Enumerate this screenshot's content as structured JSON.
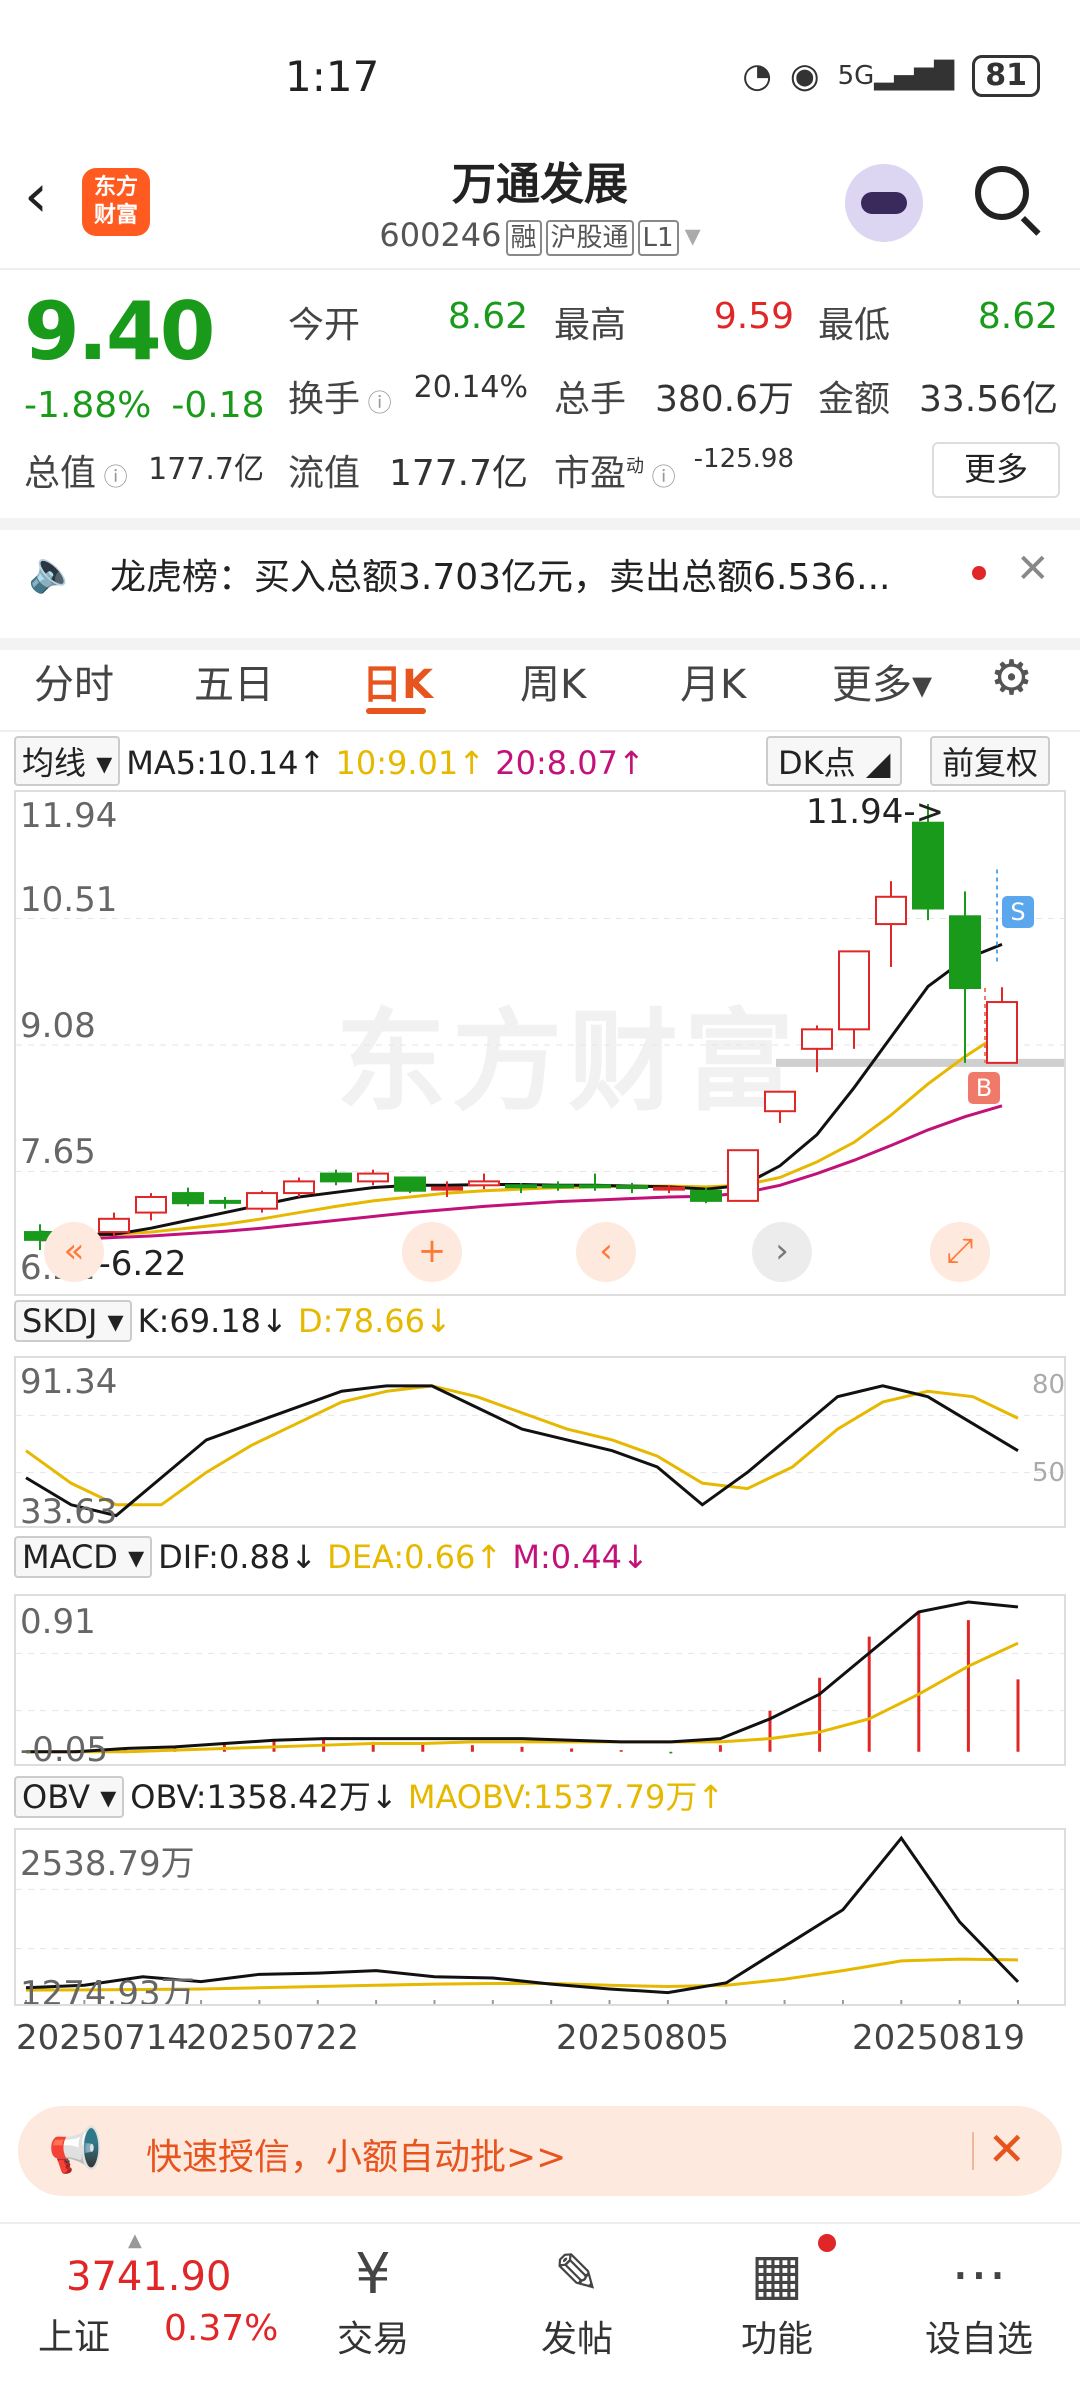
{
  "status": {
    "time": "1:17",
    "network": "5G",
    "battery": "81"
  },
  "header": {
    "back_icon": "chevron-left-icon",
    "logo_text_1": "东方",
    "logo_text_2": "财富",
    "stock_name": "万通发展",
    "stock_code": "600246",
    "tags": [
      "融",
      "沪股通",
      "L1"
    ]
  },
  "quote": {
    "price": "9.40",
    "change_pct": "-1.88%",
    "change": "-0.18",
    "open_label": "今开",
    "open": "8.62",
    "high_label": "最高",
    "high": "9.59",
    "low_label": "最低",
    "low": "8.62",
    "turnover_label": "换手",
    "turnover": "20.14%",
    "volume_label": "总手",
    "volume": "380.6万",
    "amount_label": "金额",
    "amount": "33.56亿",
    "mktcap_label": "总值",
    "mktcap": "177.7亿",
    "float_label": "流值",
    "float": "177.7亿",
    "pe_label": "市盈",
    "pe_sup": "动",
    "pe": "-125.98",
    "more_label": "更多"
  },
  "news": {
    "text": "龙虎榜：买入总额3.703亿元，卖出总额6.536..."
  },
  "tabs": [
    "分时",
    "五日",
    "日K",
    "周K",
    "月K",
    "更多▾"
  ],
  "active_tab": "日K",
  "ma_legend": {
    "selector": "均线",
    "ma5": "MA5:10.14↑",
    "ma10": "10:9.01↑",
    "ma20": "20:8.07↑",
    "dk": "DK点",
    "adjust": "前复权"
  },
  "kline_axis": [
    "11.94",
    "10.51",
    "9.08",
    "7.65",
    "6.22"
  ],
  "kline_annot": {
    "high": "11.94->",
    "low": "<-6.22",
    "s_mark": "S",
    "b_mark": "B",
    "watermark": "东方财富"
  },
  "skdj_legend": {
    "selector": "SKDJ",
    "k": "K:69.18↓",
    "d": "D:78.66↓"
  },
  "skdj_axis": {
    "top": "91.34",
    "bottom": "33.63",
    "r80": "80",
    "r50": "50"
  },
  "macd_legend": {
    "selector": "MACD",
    "dif": "DIF:0.88↓",
    "dea": "DEA:0.66↑",
    "m": "M:0.44↓"
  },
  "macd_axis": {
    "top": "0.91",
    "bottom": "-0.05"
  },
  "obv_legend": {
    "selector": "OBV",
    "obv": "OBV:1358.42万↓",
    "maobv": "MAOBV:1537.79万↑"
  },
  "obv_axis": {
    "top": "2538.79万",
    "bottom": "1274.93万"
  },
  "dates": [
    "20250714",
    "20250722",
    "20250805",
    "20250819"
  ],
  "promo": {
    "text": "快速授信，小额自动批>>"
  },
  "bottom": {
    "index_value": "3741.90",
    "index_name": "上证",
    "index_pct": "0.37%",
    "nav": [
      {
        "label": "交易",
        "icon": "yen-exchange-icon"
      },
      {
        "label": "发帖",
        "icon": "edit-icon"
      },
      {
        "label": "功能",
        "icon": "grid-icon"
      },
      {
        "label": "设自选",
        "icon": "more-icon"
      }
    ]
  },
  "colors": {
    "up": "#e02626",
    "down": "#1a9a1a",
    "accent": "#e8541e",
    "ma10": "#e6b800",
    "ma20": "#c2127a"
  },
  "chart_data": {
    "type": "candlestick",
    "title": "",
    "y_range": [
      6.22,
      11.94
    ],
    "candles": [
      {
        "o": 6.45,
        "c": 6.35,
        "h": 6.55,
        "l": 6.22
      },
      {
        "o": 6.35,
        "c": 6.42,
        "h": 6.5,
        "l": 6.28
      },
      {
        "o": 6.45,
        "c": 6.62,
        "h": 6.7,
        "l": 6.4
      },
      {
        "o": 6.7,
        "c": 6.9,
        "h": 6.95,
        "l": 6.6
      },
      {
        "o": 6.95,
        "c": 6.82,
        "h": 7.02,
        "l": 6.78
      },
      {
        "o": 6.85,
        "c": 6.83,
        "h": 6.9,
        "l": 6.75
      },
      {
        "o": 6.75,
        "c": 6.95,
        "h": 6.98,
        "l": 6.7
      },
      {
        "o": 6.95,
        "c": 7.1,
        "h": 7.15,
        "l": 6.9
      },
      {
        "o": 7.2,
        "c": 7.1,
        "h": 7.25,
        "l": 7.05
      },
      {
        "o": 7.1,
        "c": 7.2,
        "h": 7.25,
        "l": 7.05
      },
      {
        "o": 7.15,
        "c": 6.98,
        "h": 7.15,
        "l": 6.95
      },
      {
        "o": 7.0,
        "c": 7.02,
        "h": 7.1,
        "l": 6.9
      },
      {
        "o": 7.05,
        "c": 7.1,
        "h": 7.2,
        "l": 7.0
      },
      {
        "o": 7.05,
        "c": 7.03,
        "h": 7.08,
        "l": 6.95
      },
      {
        "o": 7.05,
        "c": 7.04,
        "h": 7.1,
        "l": 6.98
      },
      {
        "o": 7.05,
        "c": 7.03,
        "h": 7.2,
        "l": 6.98
      },
      {
        "o": 7.04,
        "c": 7.02,
        "h": 7.08,
        "l": 6.95
      },
      {
        "o": 7.0,
        "c": 7.02,
        "h": 7.05,
        "l": 6.95
      },
      {
        "o": 6.98,
        "c": 6.85,
        "h": 7.02,
        "l": 6.82
      },
      {
        "o": 6.85,
        "c": 7.5,
        "h": 7.5,
        "l": 6.85
      },
      {
        "o": 8.0,
        "c": 8.25,
        "h": 8.25,
        "l": 7.85
      },
      {
        "o": 8.8,
        "c": 9.05,
        "h": 9.1,
        "l": 8.5
      },
      {
        "o": 9.05,
        "c": 10.05,
        "h": 10.05,
        "l": 8.8
      },
      {
        "o": 10.4,
        "c": 10.75,
        "h": 10.95,
        "l": 9.85
      },
      {
        "o": 11.7,
        "c": 10.6,
        "h": 11.94,
        "l": 10.45
      },
      {
        "o": 10.5,
        "c": 9.58,
        "h": 10.82,
        "l": 8.62
      },
      {
        "o": 8.62,
        "c": 9.4,
        "h": 9.59,
        "l": 8.62
      }
    ],
    "ma5": [
      6.45,
      6.42,
      6.42,
      6.5,
      6.6,
      6.7,
      6.8,
      6.9,
      6.96,
      7.02,
      7.05,
      7.05,
      7.06,
      7.06,
      7.05,
      7.05,
      7.04,
      7.03,
      7.0,
      7.05,
      7.3,
      7.7,
      8.3,
      8.95,
      9.6,
      9.95,
      10.14
    ],
    "ma10": [
      6.4,
      6.4,
      6.42,
      6.45,
      6.5,
      6.55,
      6.62,
      6.7,
      6.78,
      6.85,
      6.9,
      6.95,
      6.98,
      7.0,
      7.02,
      7.03,
      7.04,
      7.04,
      7.03,
      7.05,
      7.15,
      7.35,
      7.6,
      7.95,
      8.35,
      8.7,
      9.01
    ],
    "ma20": [
      6.35,
      6.36,
      6.38,
      6.4,
      6.43,
      6.46,
      6.5,
      6.55,
      6.6,
      6.65,
      6.7,
      6.74,
      6.78,
      6.81,
      6.84,
      6.86,
      6.88,
      6.9,
      6.91,
      6.95,
      7.05,
      7.2,
      7.37,
      7.56,
      7.76,
      7.93,
      8.07
    ],
    "skdj_range": [
      33.63,
      91.34
    ],
    "skdj_k": [
      50,
      40,
      36,
      50,
      64,
      70,
      76,
      82,
      84,
      84,
      76,
      68,
      64,
      60,
      54,
      40,
      52,
      66,
      80,
      84,
      80,
      70,
      60
    ],
    "skdj_d": [
      60,
      48,
      40,
      40,
      52,
      62,
      70,
      78,
      82,
      84,
      80,
      74,
      68,
      64,
      58,
      48,
      46,
      54,
      68,
      78,
      82,
      80,
      72
    ],
    "macd_range": [
      -0.05,
      0.91
    ],
    "macd_dif": [
      0.0,
      0.0,
      0.02,
      0.03,
      0.05,
      0.07,
      0.08,
      0.08,
      0.08,
      0.08,
      0.08,
      0.07,
      0.06,
      0.06,
      0.08,
      0.2,
      0.35,
      0.6,
      0.85,
      0.91,
      0.88
    ],
    "macd_dea": [
      0.0,
      0.0,
      0.0,
      0.01,
      0.02,
      0.03,
      0.04,
      0.05,
      0.05,
      0.06,
      0.06,
      0.06,
      0.06,
      0.06,
      0.06,
      0.08,
      0.12,
      0.2,
      0.35,
      0.52,
      0.66
    ],
    "macd_m": [
      0.0,
      0.01,
      0.02,
      0.03,
      0.05,
      0.07,
      0.08,
      0.06,
      0.05,
      0.04,
      0.03,
      0.02,
      0.01,
      -0.01,
      0.04,
      0.25,
      0.45,
      0.7,
      0.85,
      0.8,
      0.44
    ],
    "obv_range": [
      1274.93,
      2538.79
    ],
    "obv": [
      1310,
      1330,
      1400,
      1360,
      1420,
      1430,
      1450,
      1400,
      1390,
      1340,
      1300,
      1270,
      1350,
      1650,
      1950,
      2538,
      1850,
      1358
    ],
    "maobv": [
      1290,
      1292,
      1295,
      1300,
      1310,
      1320,
      1330,
      1340,
      1345,
      1345,
      1330,
      1320,
      1330,
      1380,
      1450,
      1530,
      1545,
      1538
    ]
  }
}
